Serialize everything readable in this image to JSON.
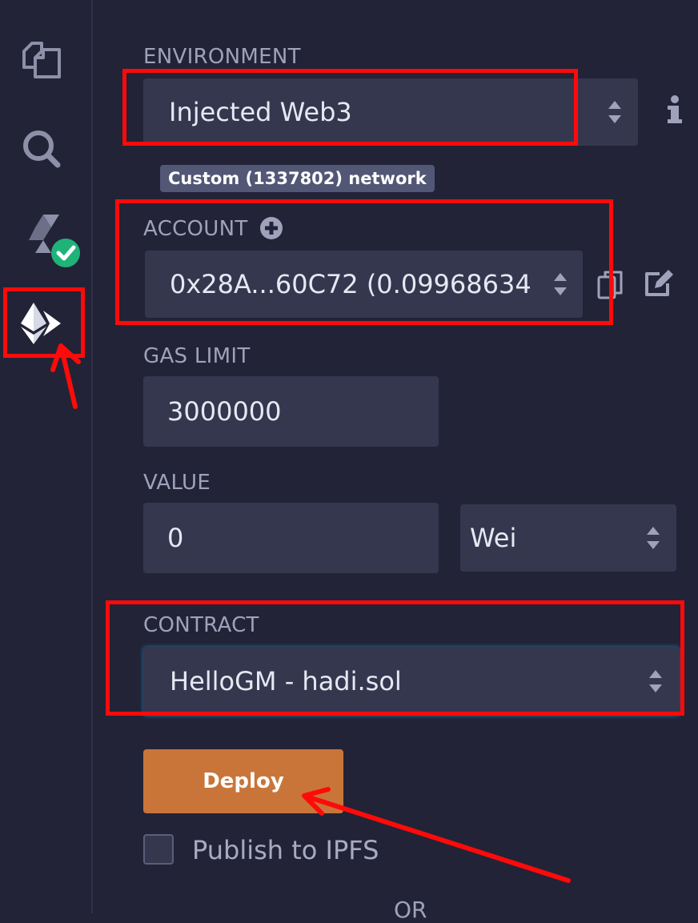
{
  "environment": {
    "label": "ENVIRONMENT",
    "value": "Injected Web3",
    "network_badge": "Custom (1337802) network",
    "info_icon": "info-icon"
  },
  "account": {
    "label": "ACCOUNT",
    "value": "0x28A...60C72 (0.09968634",
    "add_icon": "plus-circle-icon",
    "copy_icon": "copy-icon",
    "edit_icon": "edit-icon"
  },
  "gas_limit": {
    "label": "GAS LIMIT",
    "value": "3000000"
  },
  "value": {
    "label": "VALUE",
    "amount": "0",
    "unit": "Wei"
  },
  "contract": {
    "label": "CONTRACT",
    "value": "HelloGM - hadi.sol"
  },
  "deploy": {
    "label": "Deploy"
  },
  "publish": {
    "label": "Publish to IPFS",
    "checked": false
  },
  "or_divider": "OR",
  "sidebar": {
    "items": [
      {
        "icon": "file-explorer-icon"
      },
      {
        "icon": "search-icon"
      },
      {
        "icon": "solidity-compiler-icon"
      },
      {
        "icon": "deploy-run-icon"
      }
    ]
  },
  "colors": {
    "background": "#222336",
    "panel": "#35374f",
    "accent_deploy": "#c97539",
    "annotation_red": "#ff0a0a",
    "check_green": "#1fb37a"
  }
}
